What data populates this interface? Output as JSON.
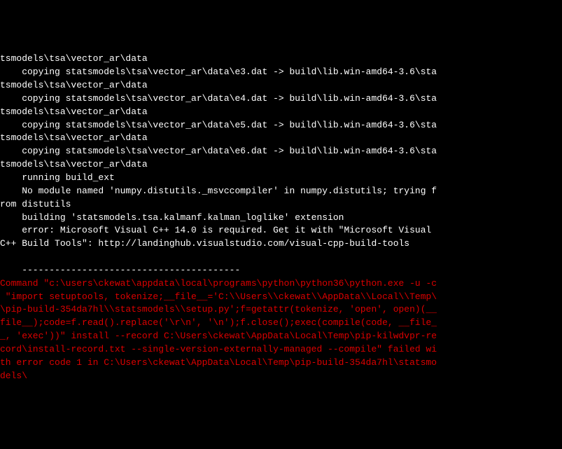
{
  "terminal": {
    "lines": [
      {
        "color": "white",
        "text": "tsmodels\\tsa\\vector_ar\\data"
      },
      {
        "color": "white",
        "text": "    copying statsmodels\\tsa\\vector_ar\\data\\e3.dat -> build\\lib.win-amd64-3.6\\sta"
      },
      {
        "color": "white",
        "text": "tsmodels\\tsa\\vector_ar\\data"
      },
      {
        "color": "white",
        "text": "    copying statsmodels\\tsa\\vector_ar\\data\\e4.dat -> build\\lib.win-amd64-3.6\\sta"
      },
      {
        "color": "white",
        "text": "tsmodels\\tsa\\vector_ar\\data"
      },
      {
        "color": "white",
        "text": "    copying statsmodels\\tsa\\vector_ar\\data\\e5.dat -> build\\lib.win-amd64-3.6\\sta"
      },
      {
        "color": "white",
        "text": "tsmodels\\tsa\\vector_ar\\data"
      },
      {
        "color": "white",
        "text": "    copying statsmodels\\tsa\\vector_ar\\data\\e6.dat -> build\\lib.win-amd64-3.6\\sta"
      },
      {
        "color": "white",
        "text": "tsmodels\\tsa\\vector_ar\\data"
      },
      {
        "color": "white",
        "text": "    running build_ext"
      },
      {
        "color": "white",
        "text": "    No module named 'numpy.distutils._msvccompiler' in numpy.distutils; trying f"
      },
      {
        "color": "white",
        "text": "rom distutils"
      },
      {
        "color": "white",
        "text": "    building 'statsmodels.tsa.kalmanf.kalman_loglike' extension"
      },
      {
        "color": "white",
        "text": "    error: Microsoft Visual C++ 14.0 is required. Get it with \"Microsoft Visual "
      },
      {
        "color": "white",
        "text": "C++ Build Tools\": http://landinghub.visualstudio.com/visual-cpp-build-tools"
      },
      {
        "color": "white",
        "text": ""
      },
      {
        "color": "white",
        "text": "    ----------------------------------------"
      },
      {
        "color": "red",
        "text": "Command \"c:\\users\\ckewat\\appdata\\local\\programs\\python\\python36\\python.exe -u -c"
      },
      {
        "color": "red",
        "text": " \"import setuptools, tokenize;__file__='C:\\\\Users\\\\ckewat\\\\AppData\\\\Local\\\\Temp\\"
      },
      {
        "color": "red",
        "text": "\\pip-build-354da7hl\\\\statsmodels\\\\setup.py';f=getattr(tokenize, 'open', open)(__"
      },
      {
        "color": "red",
        "text": "file__);code=f.read().replace('\\r\\n', '\\n');f.close();exec(compile(code, __file_"
      },
      {
        "color": "red",
        "text": "_, 'exec'))\" install --record C:\\Users\\ckewat\\AppData\\Local\\Temp\\pip-kilwdvpr-re"
      },
      {
        "color": "red",
        "text": "cord\\install-record.txt --single-version-externally-managed --compile\" failed wi"
      },
      {
        "color": "red",
        "text": "th error code 1 in C:\\Users\\ckewat\\AppData\\Local\\Temp\\pip-build-354da7hl\\statsmo"
      },
      {
        "color": "red",
        "text": "dels\\"
      }
    ]
  }
}
